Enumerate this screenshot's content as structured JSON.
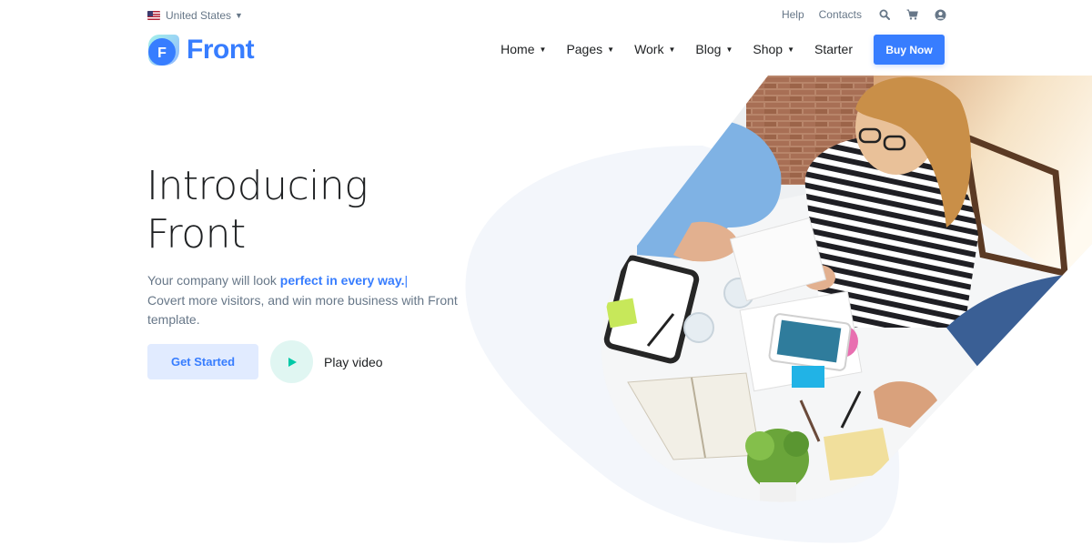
{
  "topbar": {
    "locale": "United States",
    "links": [
      "Help",
      "Contacts"
    ],
    "icons": [
      "search-icon",
      "cart-icon",
      "user-icon"
    ]
  },
  "header": {
    "brand": "Front",
    "logo_letter": "F",
    "nav": [
      "Home",
      "Pages",
      "Work",
      "Blog",
      "Shop",
      "Starter"
    ],
    "cta": "Buy Now"
  },
  "hero": {
    "title_line1": "Introducing",
    "title_line2": "Front",
    "lead_start": "Your company will look ",
    "lead_highlight": "perfect in every way.",
    "lead_cursor": "|",
    "lead_rest": "Covert more visitors, and win more business with Front template.",
    "primary_button": "Get Started",
    "video_label": "Play video"
  },
  "colors": {
    "primary": "#377dff",
    "primary_soft": "#e1ebff",
    "teal": "#00c9a7",
    "teal_soft": "#e0f6f2",
    "text": "#1e2022",
    "muted": "#677788",
    "blob": "#f3f6fb"
  }
}
